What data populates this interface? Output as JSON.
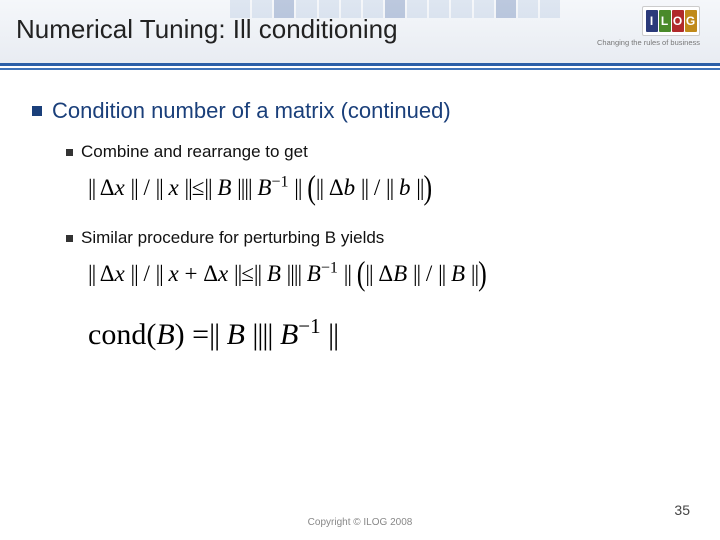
{
  "header": {
    "title": "Numerical Tuning: Ill conditioning",
    "logo_letters": [
      "I",
      "L",
      "O",
      "G"
    ],
    "tagline": "Changing the rules of business"
  },
  "content": {
    "heading": "Condition number of a matrix (continued)",
    "sub1": "Combine and rearrange to get",
    "eq1": "|| Δx || / || x || ≤ || B |||| B⁻¹ || (|| Δb || / || b ||)",
    "sub2": "Similar procedure for perturbing B yields",
    "eq2": "|| Δx || / || x + Δx || ≤ || B |||| B⁻¹ || (|| ΔB || / || B ||)",
    "eq3": "cond(B) = || B |||| B⁻¹ ||"
  },
  "footer": {
    "copyright": "Copyright © ILOG 2008",
    "page": "35"
  }
}
